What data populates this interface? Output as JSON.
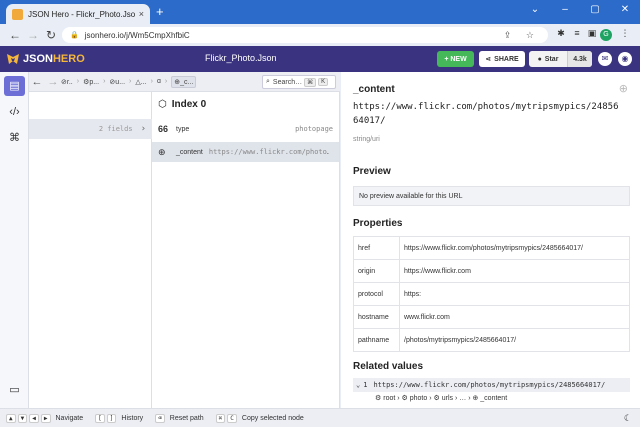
{
  "browser": {
    "tab_title": "JSON Hero - Flickr_Photo.Json",
    "tab_close": "×",
    "new_tab": "+",
    "window_controls": [
      "⌄",
      "–",
      "▢",
      "✕"
    ],
    "url": "jsonhero.io/j/Wm5CmpXhfbiC",
    "url_right_icons": "⇪ ☆",
    "profile_initial": "G"
  },
  "app": {
    "logo_json": "JSON",
    "logo_hero": "HERO",
    "file_name": "Flickr_Photo.Json",
    "new_button": "+ NEW",
    "share_button": "SHARE",
    "star_label": "Star",
    "star_count": "4.3k",
    "brand_color": "#3a3480",
    "accent_color": "#f5b73b"
  },
  "toolbar": {
    "back": "←",
    "forward": "→",
    "breadcrumbs": [
      "r..",
      "p...",
      "u...",
      "...",
      "",
      "_c..."
    ],
    "search_placeholder": "Search…",
    "search_kbd1": "⌘",
    "search_kbd2": "K"
  },
  "column1": {
    "summary": "2 fields",
    "chevron": "›"
  },
  "column2": {
    "title": "Index 0",
    "fields": [
      {
        "icon": "66",
        "key": "type",
        "value": "photopage"
      },
      {
        "icon": "🌐",
        "key": "_content",
        "value": "https://www.flickr.com/photo…"
      }
    ]
  },
  "detail": {
    "key": "_content",
    "value": "https://www.flickr.com/photos/mytripsmypics/2485664017/",
    "type": "string/uri",
    "preview_heading": "Preview",
    "preview_text": "No preview available for this URL",
    "properties_heading": "Properties",
    "properties": [
      {
        "key": "href",
        "value": "https://www.flickr.com/photos/mytripsmypics/2485664017/"
      },
      {
        "key": "origin",
        "value": "https://www.flickr.com"
      },
      {
        "key": "protocol",
        "value": "https:"
      },
      {
        "key": "hostname",
        "value": "www.flickr.com"
      },
      {
        "key": "pathname",
        "value": "/photos/mytripsmypics/2485664017/"
      }
    ],
    "related_heading": "Related values",
    "related_count": "1",
    "related_value": "https://www.flickr.com/photos/mytripsmypics/2485664017/",
    "related_path": [
      "root",
      "photo",
      "urls",
      "…",
      "_content"
    ]
  },
  "footer": {
    "items": [
      {
        "keys": [
          "▲",
          "▼",
          "◀",
          "▶"
        ],
        "label": "Navigate"
      },
      {
        "keys": [
          "[",
          "]"
        ],
        "label": "History"
      },
      {
        "keys": [
          "⌫"
        ],
        "label": "Reset path"
      },
      {
        "keys": [
          "⌘",
          "C"
        ],
        "label": "Copy selected node"
      }
    ]
  }
}
